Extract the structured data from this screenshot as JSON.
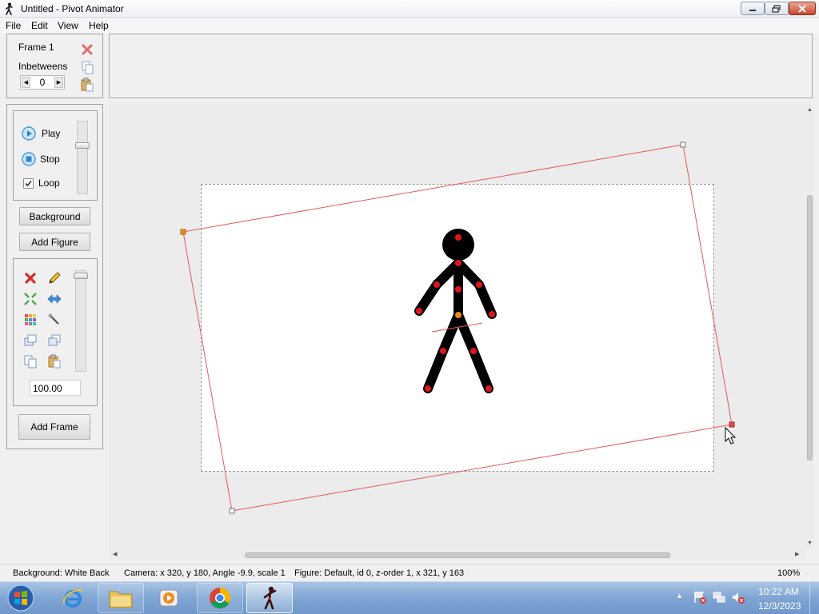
{
  "window": {
    "title": "Untitled - Pivot Animator"
  },
  "menu": [
    "File",
    "Edit",
    "View",
    "Help"
  ],
  "frame_panel": {
    "frame_label": "Frame 1",
    "inbetweens_label": "Inbetweens",
    "inbetweens_value": "0"
  },
  "playback": {
    "play_label": "Play",
    "stop_label": "Stop",
    "loop_label": "Loop",
    "loop_checked": true
  },
  "buttons": {
    "background": "Background",
    "add_figure": "Add Figure",
    "add_frame": "Add Frame"
  },
  "tools": {
    "scale_value": "100.00",
    "icons": [
      "delete-icon",
      "edit-pencil-icon",
      "center-icon",
      "flip-icon",
      "color-grid-icon",
      "pick-tool-icon",
      "front-icon",
      "back-icon",
      "copy-icon",
      "paste-icon"
    ]
  },
  "status": {
    "background": "Background: White Back",
    "camera": "Camera: x 320, y 180, Angle -9.9, scale 1",
    "figure": "Figure: Default,  id 0,  z-order 1,  x 321, y 163",
    "zoom": "100%"
  },
  "taskbar": {
    "items": [
      "start-icon",
      "ie-icon",
      "explorer-icon",
      "media-player-icon",
      "chrome-icon",
      "pivot-icon"
    ],
    "time": "10:22 AM",
    "date": "12/3/2023"
  },
  "colors": {
    "joint_red": "#e3141b",
    "joint_orange": "#f08a1c",
    "camera_rect": "#e35a5a"
  }
}
